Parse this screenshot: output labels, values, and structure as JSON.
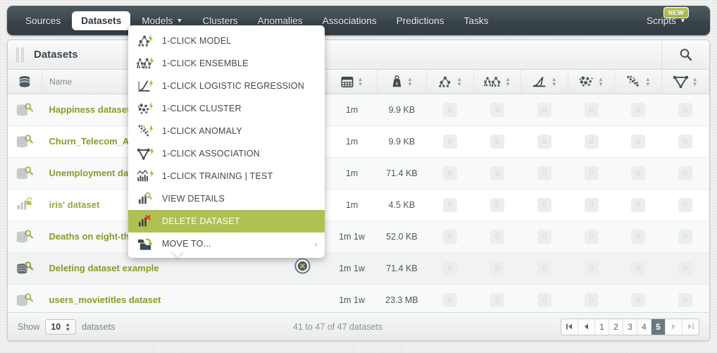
{
  "nav": {
    "items": [
      {
        "label": "Sources",
        "active": false,
        "caret": false
      },
      {
        "label": "Datasets",
        "active": true,
        "caret": false
      },
      {
        "label": "Models",
        "active": false,
        "caret": true
      },
      {
        "label": "Clusters",
        "active": false,
        "caret": false
      },
      {
        "label": "Anomalies",
        "active": false,
        "caret": false
      },
      {
        "label": "Associations",
        "active": false,
        "caret": false
      },
      {
        "label": "Predictions",
        "active": false,
        "caret": false
      },
      {
        "label": "Tasks",
        "active": false,
        "caret": false
      }
    ],
    "right": {
      "label": "Scripts",
      "caret": true,
      "badge": "NEW"
    }
  },
  "panel": {
    "title": "Datasets",
    "search_icon": "search-icon"
  },
  "menu": {
    "items": [
      {
        "label": "1-CLICK MODEL",
        "icon": "model-bolt-icon",
        "selected": false,
        "submenu": false
      },
      {
        "label": "1-CLICK ENSEMBLE",
        "icon": "ensemble-bolt-icon",
        "selected": false,
        "submenu": false
      },
      {
        "label": "1-CLICK LOGISTIC REGRESSION",
        "icon": "logistic-regression-bolt-icon",
        "selected": false,
        "submenu": false
      },
      {
        "label": "1-CLICK CLUSTER",
        "icon": "cluster-bolt-icon",
        "selected": false,
        "submenu": false
      },
      {
        "label": "1-CLICK ANOMALY",
        "icon": "anomaly-bolt-icon",
        "selected": false,
        "submenu": false
      },
      {
        "label": "1-CLICK ASSOCIATION",
        "icon": "association-bolt-icon",
        "selected": false,
        "submenu": false
      },
      {
        "label": "1-CLICK TRAINING | TEST",
        "icon": "training-test-bolt-icon",
        "selected": false,
        "submenu": false
      },
      {
        "label": "VIEW DETAILS",
        "icon": "bars-search-icon",
        "selected": false,
        "submenu": false
      },
      {
        "label": "DELETE DATASET",
        "icon": "bars-delete-icon",
        "selected": true,
        "submenu": false
      },
      {
        "label": "MOVE TO...",
        "icon": "folder-move-icon",
        "selected": false,
        "submenu": true
      }
    ],
    "submenu_arrow": "chevron-right-icon",
    "highlight_color": "#b0c052"
  },
  "table": {
    "headers": [
      {
        "icon": "database-icon",
        "label": "",
        "type": "icon"
      },
      {
        "icon": "",
        "label": "Name",
        "type": "name"
      },
      {
        "icon": "calendar-icon",
        "label": "",
        "type": "val"
      },
      {
        "icon": "weight-icon",
        "label": "",
        "type": "val"
      },
      {
        "icon": "model-icon",
        "label": "",
        "type": "cnt"
      },
      {
        "icon": "ensemble-icon",
        "label": "",
        "type": "cnt"
      },
      {
        "icon": "logistic-regression-icon",
        "label": "",
        "type": "cnt"
      },
      {
        "icon": "cluster-icon",
        "label": "",
        "type": "cnt"
      },
      {
        "icon": "anomaly-icon",
        "label": "",
        "type": "cnt"
      },
      {
        "icon": "association-icon",
        "label": "",
        "type": "cnt"
      }
    ],
    "rows": [
      {
        "icon": "database-search-icon",
        "name": "Happiness dataset",
        "age": "1m",
        "size": "9.9 KB",
        "counts": [
          "0",
          "0",
          "0",
          "0",
          "0",
          "0"
        ],
        "name_style": "bold"
      },
      {
        "icon": "database-search-icon",
        "name": "Churn_Telecom_A",
        "age": "1m",
        "size": "9.9 KB",
        "counts": [
          "0",
          "0",
          "0",
          "0",
          "0",
          "0"
        ],
        "name_style": "bold"
      },
      {
        "icon": "database-search-icon",
        "name": "Unemployment da",
        "age": "1m",
        "size": "71.4 KB",
        "counts": [
          "0",
          "0",
          "0",
          "0",
          "0",
          "0"
        ],
        "name_style": "bold"
      },
      {
        "icon": "bars-unlock-icon",
        "name": "iris' dataset",
        "age": "1m",
        "size": "4.5 KB",
        "counts": [
          "0",
          "0",
          "0",
          "0",
          "0",
          "0"
        ],
        "name_style": "light"
      },
      {
        "icon": "database-search-icon",
        "name": "Deaths on eight-th",
        "age": "1m 1w",
        "size": "52.0 KB",
        "counts": [
          "0",
          "0",
          "0",
          "0",
          "0",
          "0"
        ],
        "name_style": "bold"
      },
      {
        "icon": "database-search-dark-icon",
        "name": "Deleting dataset example",
        "age": "1m 1w",
        "size": "71.4 KB",
        "counts": [
          "0",
          "0",
          "0",
          "0",
          "0",
          "0"
        ],
        "name_style": "bold"
      },
      {
        "icon": "database-search-icon",
        "name": "users_movietitles dataset",
        "age": "1m 1w",
        "size": "23.3 MB",
        "counts": [
          "0",
          "0",
          "0",
          "0",
          "0",
          "0"
        ],
        "name_style": "bold"
      }
    ]
  },
  "footer": {
    "show_label": "Show",
    "page_size": "10",
    "datasets_label": "datasets",
    "range_text": "41 to 47 of 47 datasets",
    "pager": [
      {
        "label": "|◀",
        "name": "first-page",
        "state": "normal",
        "icon": "first-page-icon"
      },
      {
        "label": "◀",
        "name": "prev-page",
        "state": "normal",
        "icon": "prev-page-icon"
      },
      {
        "label": "1",
        "name": "page-1",
        "state": "normal",
        "icon": ""
      },
      {
        "label": "2",
        "name": "page-2",
        "state": "normal",
        "icon": ""
      },
      {
        "label": "3",
        "name": "page-3",
        "state": "normal",
        "icon": ""
      },
      {
        "label": "4",
        "name": "page-4",
        "state": "normal",
        "icon": ""
      },
      {
        "label": "5",
        "name": "page-5",
        "state": "active",
        "icon": ""
      },
      {
        "label": "▶",
        "name": "next-page",
        "state": "disabled",
        "icon": "next-page-icon"
      },
      {
        "label": "▶|",
        "name": "last-page",
        "state": "disabled",
        "icon": "last-page-icon"
      }
    ]
  },
  "overlay": {
    "close_button": "close-dataset-popup"
  },
  "colors": {
    "nav_bg": "#3f4a50",
    "accent_green": "#8a9a23",
    "menu_highlight": "#b0c052",
    "badge_new": "#aeba52"
  }
}
